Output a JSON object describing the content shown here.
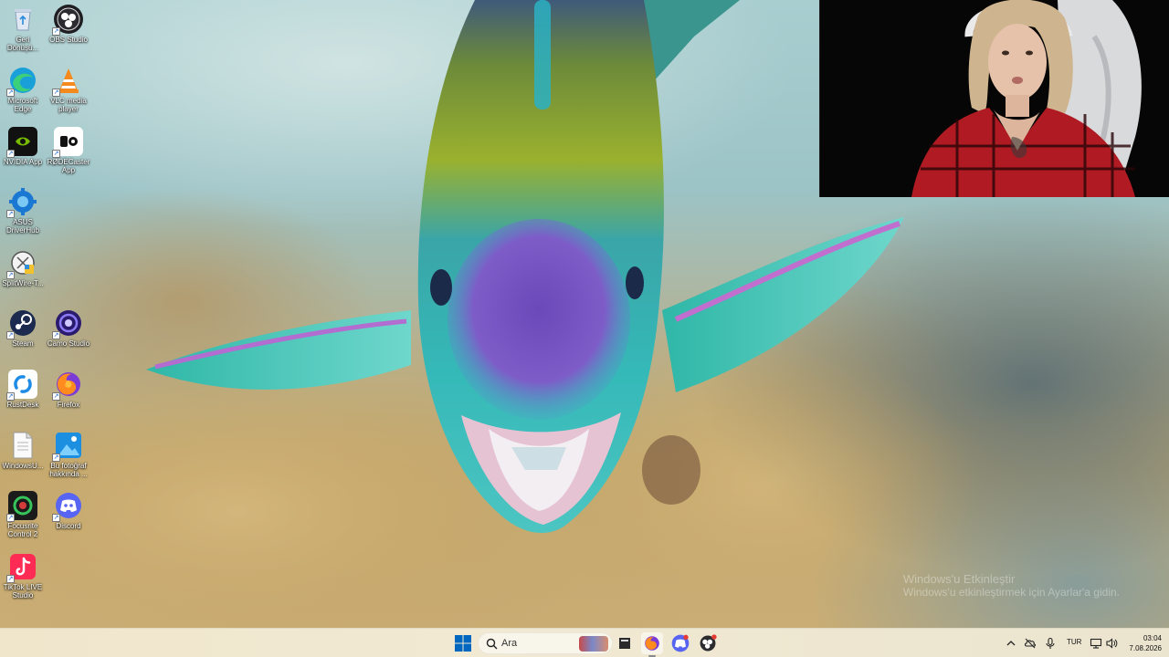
{
  "desktop_icons": [
    {
      "label": "Geri Dönüşü...",
      "icon": "recycle-bin-icon"
    },
    {
      "label": "OBS Studio",
      "icon": "obs-icon"
    },
    {
      "label": "Microsoft Edge",
      "icon": "edge-icon"
    },
    {
      "label": "VLC media player",
      "icon": "vlc-icon"
    },
    {
      "label": "NVIDIA App",
      "icon": "nvidia-icon"
    },
    {
      "label": "RØDECaster App",
      "icon": "rodecaster-icon"
    },
    {
      "label": "ASUS DriverHub",
      "icon": "asus-driverhub-icon"
    },
    {
      "label": "SplitWire-T...",
      "icon": "splitwire-icon"
    },
    {
      "label": "Steam",
      "icon": "steam-icon"
    },
    {
      "label": "Camo Studio",
      "icon": "camo-icon"
    },
    {
      "label": "RustDesk",
      "icon": "rustdesk-icon"
    },
    {
      "label": "Firefox",
      "icon": "firefox-icon"
    },
    {
      "label": "WindowsU...",
      "icon": "text-file-icon"
    },
    {
      "label": "Bu fotoğraf hakkında ...",
      "icon": "photo-info-icon"
    },
    {
      "label": "Focusrite Control 2",
      "icon": "focusrite-icon"
    },
    {
      "label": "Discord",
      "icon": "discord-icon"
    },
    {
      "label": "TikTok LIVE Studio",
      "icon": "tiktok-live-icon"
    }
  ],
  "watermark": {
    "title": "Windows'u Etkinleştir",
    "subtitle": "Windows'u etkinleştirmek için Ayarlar'a gidin."
  },
  "taskbar": {
    "search_placeholder": "Ara",
    "apps": [
      {
        "name": "file-explorer-icon"
      },
      {
        "name": "firefox-icon",
        "active": true
      },
      {
        "name": "discord-icon",
        "badge": true
      },
      {
        "name": "obs-icon",
        "badge": true
      }
    ],
    "tray": {
      "language": "TUR",
      "time": "03:04",
      "date": "7.08.2026"
    }
  },
  "colors": {
    "taskbar_bg": "#efe6cc",
    "accent_blue": "#0067c0"
  }
}
